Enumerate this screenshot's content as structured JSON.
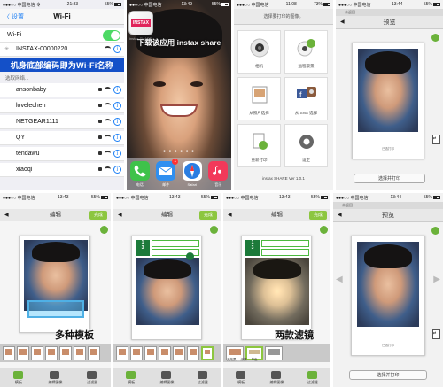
{
  "wifi_screen": {
    "status": {
      "carrier": "●●●○○ 中国电信 令",
      "time": "21:33",
      "battery": "55%"
    },
    "nav": {
      "back": "〈 设置",
      "title": "Wi-Fi"
    },
    "wifi_label": "Wi-Fi",
    "connected": "INSTAX-00000220",
    "banner": "机身底部编码即为Wi-Fi名称",
    "choose_network": "选取网络...",
    "networks": [
      "ansonbaby",
      "lovelechen",
      "NETGEAR1111",
      "QY",
      "tendawu",
      "xiaoqi"
    ]
  },
  "home_screen": {
    "status": {
      "carrier": "●●●○○ 中国电信",
      "time": "13:49",
      "battery": "55%"
    },
    "app_icon_brand": "INSTAX",
    "app_label": "instax SHARE",
    "headline": "下载该应用 instax share",
    "page_dots": "● ● ● ● ● ●",
    "dock": [
      {
        "label": "电话",
        "color": "#3fc24a"
      },
      {
        "label": "邮件",
        "color": "#2f8ff0",
        "badge": "1"
      },
      {
        "label": "Safari",
        "color": "#2a7de1"
      },
      {
        "label": "音乐",
        "color": "#f2395a"
      }
    ]
  },
  "menu_screen": {
    "status": {
      "carrier": "●●●○○ 中国电信",
      "time": "11:08",
      "battery": "73%"
    },
    "header": "选择要打印的图像。",
    "tiles": [
      {
        "label": "相机",
        "icon": "camera-icon"
      },
      {
        "label": "远程取景",
        "icon": "remote-icon"
      },
      {
        "label": "从照片选择",
        "icon": "photo-library-icon"
      },
      {
        "label": "从 SNS 选择",
        "icon": "sns-icon"
      },
      {
        "label": "重新打印",
        "icon": "reprint-icon"
      },
      {
        "label": "设定",
        "icon": "settings-icon"
      }
    ],
    "version": "instax SHARE Ver 1.0.1"
  },
  "preview_top": {
    "status": {
      "carrier": "●●●○○ 中国电信",
      "time": "13:44",
      "battery": "55%"
    },
    "title": "预览",
    "sub": "未返回",
    "caption": "已选打印",
    "button": "选择并打印"
  },
  "edit1": {
    "status": {
      "carrier": "●●●○○ 中国电信",
      "time": "13:43",
      "battery": "55%"
    },
    "title": "编辑",
    "done": "完成",
    "overlay": "多种模板",
    "tabs": [
      "模板",
      "编辑图像",
      "过滤器"
    ]
  },
  "edit2": {
    "status": {
      "carrier": "●●●○○ 中国电信",
      "time": "13:43",
      "battery": "55%"
    },
    "title": "编辑",
    "done": "完成",
    "frame_num": "1",
    "frame_den": "3",
    "tabs": [
      "模板",
      "编辑图像",
      "过滤器"
    ]
  },
  "edit3": {
    "status": {
      "carrier": "●●●○○ 中国电信",
      "time": "13:43",
      "battery": "55%"
    },
    "title": "编辑",
    "done": "完成",
    "frame_num": "1",
    "frame_den": "3",
    "overlay": "两款滤镜",
    "filters": [
      "无效果",
      "深褐",
      "单色"
    ],
    "tabs": [
      "模板",
      "编辑图像",
      "过滤器"
    ]
  },
  "preview_bottom": {
    "status": {
      "carrier": "●●●○○ 中国电信",
      "time": "13:44",
      "battery": "55%"
    },
    "title": "预览",
    "sub": "未返回",
    "caption": "已选打印",
    "button": "选择并打印"
  }
}
